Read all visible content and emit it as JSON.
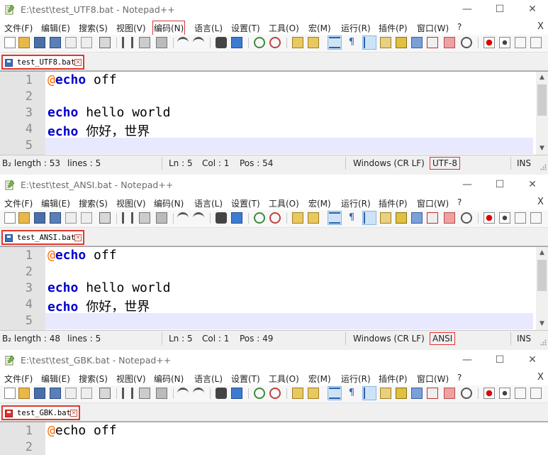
{
  "app": {
    "minimize_glyph": "—",
    "maximize_glyph": "☐",
    "close_glyph": "✕",
    "menu_close_glyph": "X",
    "tab_close_glyph": "×"
  },
  "menu": [
    "文件(F)",
    "编辑(E)",
    "搜索(S)",
    "视图(V)",
    "编码(N)",
    "语言(L)",
    "设置(T)",
    "工具(O)",
    "宏(M)",
    "运行(R)",
    "插件(P)",
    "窗口(W)",
    "?"
  ],
  "windows": [
    {
      "title": "E:\\test\\test_UTF8.bat - Notepad++",
      "tab": "test_UTF8.bat",
      "line_numbers": [
        "1",
        "2",
        "3",
        "4",
        "5"
      ],
      "code": {
        "l1_at": "@",
        "l1_kw": "echo",
        "l1_rest": " off",
        "l3_kw": "echo",
        "l3_rest": " hello world",
        "l4_kw": "echo",
        "l4_rest": " 你好，世界"
      },
      "status": {
        "length": "B₂ length : 53",
        "lines": "lines : 5",
        "ln": "Ln : 5",
        "col": "Col : 1",
        "pos": "Pos : 54",
        "eol": "Windows (CR LF)",
        "encoding": "UTF-8",
        "ins": "INS"
      }
    },
    {
      "title": "E:\\test\\test_ANSI.bat - Notepad++",
      "tab": "test_ANSI.bat",
      "line_numbers": [
        "1",
        "2",
        "3",
        "4",
        "5"
      ],
      "code": {
        "l1_at": "@",
        "l1_kw": "echo",
        "l1_rest": " off",
        "l3_kw": "echo",
        "l3_rest": " hello world",
        "l4_kw": "echo",
        "l4_rest": " 你好，世界"
      },
      "status": {
        "length": "B₂ length : 48",
        "lines": "lines : 5",
        "ln": "Ln : 5",
        "col": "Col : 1",
        "pos": "Pos : 49",
        "eol": "Windows (CR LF)",
        "encoding": "ANSI",
        "ins": "INS"
      }
    },
    {
      "title": "E:\\test\\test_GBK.bat - Notepad++",
      "tab": "test_GBK.bat",
      "line_numbers": [
        "1",
        "2"
      ],
      "code": {
        "l1_at": "@",
        "l1_kw": "echo",
        "l1_rest": " off"
      }
    }
  ],
  "colors": {
    "keyword": "#0000cc",
    "at_sign": "#ff6a00",
    "highlight_outline": "#d33333",
    "current_line": "#e8e8ff"
  }
}
